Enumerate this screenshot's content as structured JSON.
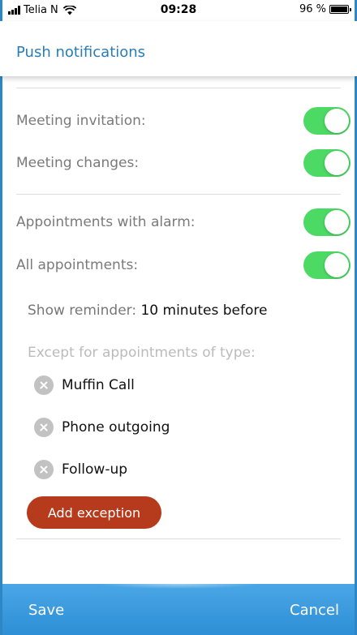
{
  "status_bar": {
    "carrier": "Telia N",
    "time": "09:28",
    "battery": "96 %"
  },
  "header": {
    "title": "Push notifications"
  },
  "toggles": [
    {
      "label": "Meeting invitation:",
      "on": true
    },
    {
      "label": "Meeting changes:",
      "on": true
    },
    {
      "label": "Appointments with alarm:",
      "on": true
    },
    {
      "label": "All appointments:",
      "on": true
    }
  ],
  "reminder": {
    "label": "Show reminder:",
    "value": "10 minutes before"
  },
  "exceptions": {
    "label": "Except for appointments of type:",
    "items": [
      "Muffin Call",
      "Phone outgoing",
      "Follow-up"
    ],
    "add_label": "Add exception"
  },
  "footer": {
    "save_label": "Save",
    "cancel_label": "Cancel"
  },
  "colors": {
    "accent": "#2a7cb6",
    "toggle_on": "#4cd964",
    "add_button": "#b63a1c",
    "footer": "#3b9be0"
  }
}
